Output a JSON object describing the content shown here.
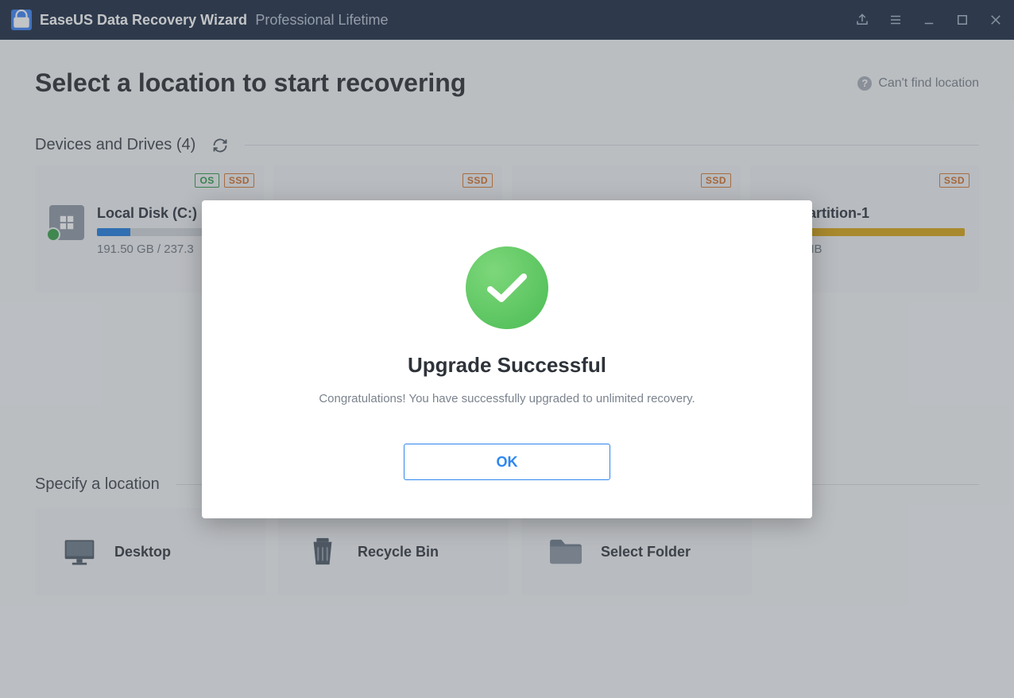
{
  "app": {
    "title": "EaseUS Data Recovery Wizard",
    "subtitle": "Professional Lifetime"
  },
  "header": {
    "page_title": "Select a location to start recovering",
    "help_text": "Can't find location"
  },
  "devices": {
    "section_label": "Devices and Drives (4)",
    "cards": [
      {
        "name": "Local Disk (C:)",
        "size": "191.50 GB / 237.3",
        "os_badge": "OS",
        "ssd_badge": "SSD",
        "fill_color": "#1f7de0",
        "fill_pct": "22%"
      },
      {
        "ssd_badge": "SSD"
      },
      {
        "ssd_badge": "SSD"
      },
      {
        "name": "Lost Partition-1",
        "size": "640.00 MB",
        "ssd_badge": "SSD",
        "fill_color": "#d9a514",
        "fill_pct": "100%"
      }
    ]
  },
  "locations": {
    "section_label": "Specify a location",
    "items": [
      {
        "label": "Desktop"
      },
      {
        "label": "Recycle Bin"
      },
      {
        "label": "Select Folder"
      }
    ]
  },
  "modal": {
    "title": "Upgrade Successful",
    "message": "Congratulations! You have successfully upgraded to unlimited recovery.",
    "ok": "OK"
  }
}
